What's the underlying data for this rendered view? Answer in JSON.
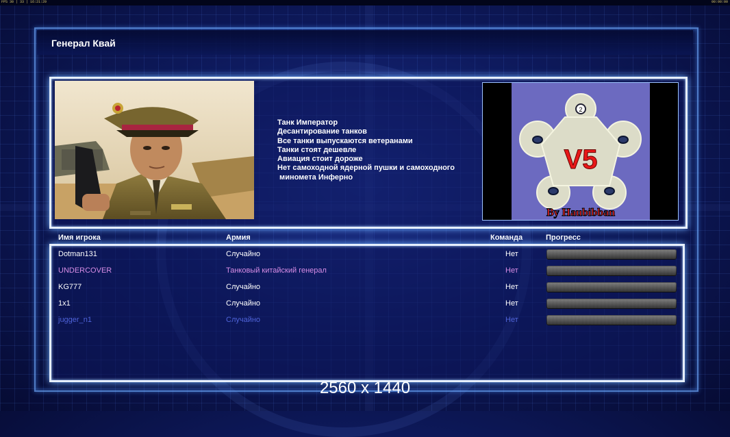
{
  "hud": {
    "left": "FPS 30 | 33 | 16:21:29",
    "right": "00:00:00"
  },
  "general": {
    "title": "Генерал Квай",
    "traits": [
      "Танк Император",
      "Десантирование танков",
      "Все танки выпускаются ветеранами",
      "Танки стоят дешевле",
      "Авиация стоит дороже",
      "Нет самоходной ядерной пушки и самоходного",
      " минометa Инферно"
    ]
  },
  "map": {
    "title": "V5",
    "author": "By Haubibban",
    "player_slot": "2"
  },
  "table": {
    "headers": {
      "player": "Имя игрока",
      "army": "Армия",
      "team": "Команда",
      "progress": "Прогресс"
    },
    "rows": [
      {
        "player": "Dotman131",
        "army": "Случайно",
        "team": "Нет",
        "color": "#ffffff",
        "progress": 0
      },
      {
        "player": "UNDERCOVER",
        "army": "Танковый китайский генерал",
        "team": "Нет",
        "color": "#d88ee6",
        "progress": 0
      },
      {
        "player": "KG777",
        "army": "Случайно",
        "team": "Нет",
        "color": "#ffffff",
        "progress": 0
      },
      {
        "player": "1x1",
        "army": "Случайно",
        "team": "Нет",
        "color": "#ffffff",
        "progress": 0
      },
      {
        "player": "jugger_n1",
        "army": "Случайно",
        "team": "Нет",
        "color": "#4f63d9",
        "progress": 0
      }
    ]
  },
  "resolution": "2560 x 1440"
}
